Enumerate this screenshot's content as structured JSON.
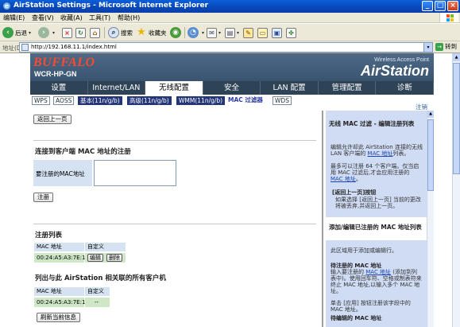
{
  "window": {
    "title": "AirStation Settings - Microsoft Internet Explorer",
    "buttons": {
      "min": "_",
      "max": "□",
      "close": "×"
    }
  },
  "menu": [
    "编辑(E)",
    "查看(V)",
    "收藏(A)",
    "工具(T)",
    "帮助(H)"
  ],
  "toolbar": {
    "back": "后退",
    "search": "搜索",
    "favorites": "收藏夹"
  },
  "address": {
    "label": "地址(D)",
    "url": "http://192.168.11.1/index.html",
    "go": "转到"
  },
  "brand": {
    "logo": "BUFFALO",
    "model": "WCR-HP-GN",
    "tagline": "Wireless Access Point",
    "product": "AirStation"
  },
  "nav": {
    "tabs": [
      "设置",
      "Internet/LAN",
      "无线配置",
      "安全",
      "LAN 配置",
      "管理配置",
      "诊断"
    ],
    "active_index": 2
  },
  "subnav": {
    "items": [
      "WPS",
      "AOSS",
      "基本(11n/g/b)",
      "高级(11n/g/b)",
      "WMM(11n/g/b)",
      "MAC 过滤器",
      "WDS"
    ],
    "current": "MAC 过滤器",
    "logout": "注销"
  },
  "main": {
    "back_button": "返回上一页",
    "register_title": "连接到客户端  MAC 地址的注册",
    "mac_field_label": "要注册的MAC地址",
    "mac_field_value": "",
    "register_button": "注册",
    "list_title": "注册列表",
    "list_headers": [
      "MAC 地址",
      "自定义"
    ],
    "list_rows": [
      {
        "mac": "00:24:A5:A3:7E:1D",
        "edit": "编辑",
        "delete": "删除"
      }
    ],
    "assoc_title": "列出与此  AirStation 相关联的所有客户机",
    "assoc_headers": [
      "MAC 地址",
      "自定义"
    ],
    "assoc_rows": [
      {
        "mac": "00:24:A5:A3:7E:1D",
        "custom": "--"
      }
    ],
    "refresh_button": "刷新当前信息"
  },
  "help": {
    "title": "无线 MAC 过滤 - 编辑注册列表",
    "p1_pre": "编辑允许却此 AirStation 连接的无线 LAN 客户端的 ",
    "p1_link": "MAC 地址",
    "p1_post": "列表。",
    "p2_pre": "最多可以注册 64 个客户端。仅当启用 MAC 过滤后,才会应用注册的 ",
    "p2_link": "MAC 地址",
    "p2_post": "。",
    "back_sub": "[返回上一页]按钮",
    "back_text": "如果选择 [返回上一页] 当前的更改将被丢弃,并返回上一页。",
    "add_title": "添加/编辑已注册的 MAC 地址列表",
    "add_text": "此区域用于添加或编辑行。",
    "reg_sub": "待注册的 MAC 地址",
    "reg_text_pre": "输入要注册的 ",
    "reg_text_link": "MAC 地址",
    "reg_text_post": " (添加到列表中)。使用回车符、空格或制表符来终止 MAC 地址,以输入多个 MAC 地址。",
    "apply_text": "单击 [应用] 按钮注册该字段中的 MAC 地址。",
    "cut_sub": "待编辑的 MAC 地址"
  }
}
